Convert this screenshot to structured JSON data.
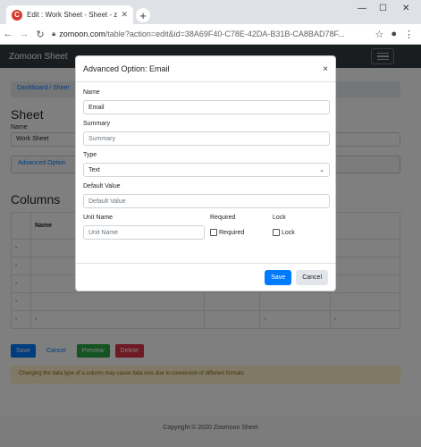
{
  "browser": {
    "tab_title": "Edit : Work Sheet - Sheet - zo",
    "favicon_letter": "C",
    "url_host": "zomoon.com",
    "url_path": "/table?action=edit&id=38A69F40-C78E-42DA-B31B-CA8BAD78F..."
  },
  "app": {
    "brand": "Zomoon Sheet",
    "breadcrumb": "Dashboard  /  Sheet",
    "page_title": "Sheet",
    "name_label": "Name",
    "name_value": "Work Sheet",
    "advanced_option_label": "Advanced Option",
    "columns_title": "Columns",
    "table_header_name": "Name",
    "row_dash": "-",
    "buttons": {
      "save": "Save",
      "cancel": "Cancel",
      "preview": "Preview",
      "delete": "Delete"
    },
    "warning": "Changing the data type of a column may cause data loss due to conversion of different formats",
    "footer": "Copyright © 2020 Zoomoon Sheet"
  },
  "modal": {
    "title": "Advanced Option: Email",
    "name_label": "Name",
    "name_value": "Email",
    "summary_label": "Summary",
    "summary_placeholder": "Summary",
    "type_label": "Type",
    "type_value": "Text",
    "default_label": "Default Value",
    "default_placeholder": "Default Value",
    "unit_label": "Unit Name",
    "unit_placeholder": "Unit Name",
    "required_label": "Required",
    "required_check": "Required",
    "lock_label": "Lock",
    "lock_check": "Lock",
    "save": "Save",
    "cancel": "Cancel",
    "close_glyph": "×"
  }
}
